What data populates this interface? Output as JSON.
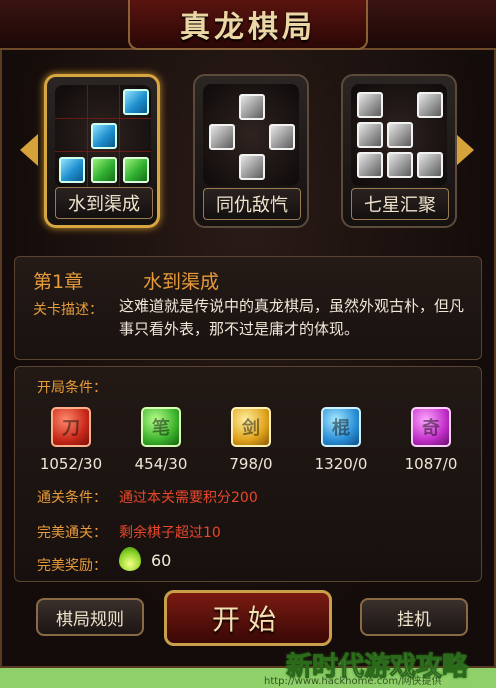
{
  "title": "真龙棋局",
  "levels": [
    {
      "label": "水到渠成",
      "selected": true
    },
    {
      "label": "同仇敌忾",
      "selected": false
    },
    {
      "label": "七星汇聚",
      "selected": false
    }
  ],
  "info": {
    "chapter": "第1章",
    "level_name": "水到渠成",
    "desc_label": "关卡描述：",
    "desc_text": "这难道就是传说中的真龙棋局，虽然外观古朴，但凡事只看外表，那不过是庸才的体现。"
  },
  "conditions": {
    "title": "开局条件：",
    "gems": [
      {
        "color": "#c8281a",
        "glyph": "刀",
        "count": "1052/30"
      },
      {
        "color": "#3cb22c",
        "glyph": "笔",
        "count": "454/30"
      },
      {
        "color": "#e0a21c",
        "glyph": "剑",
        "count": "798/0"
      },
      {
        "color": "#2a8fd6",
        "glyph": "棍",
        "count": "1320/0"
      },
      {
        "color": "#c12ec8",
        "glyph": "奇",
        "count": "1087/0"
      }
    ],
    "pass_label": "通关条件：",
    "pass_value": "通过本关需要积分200",
    "perfect_label": "完美通关：",
    "perfect_value": "剩余棋子超过10",
    "reward_label": "完美奖励：",
    "reward_value": "60"
  },
  "buttons": {
    "rules": "棋局规则",
    "start": "开始",
    "idle": "挂机"
  },
  "watermark": "新时代游戏攻略",
  "url": "http://www.hackhome.com/网侠提供"
}
